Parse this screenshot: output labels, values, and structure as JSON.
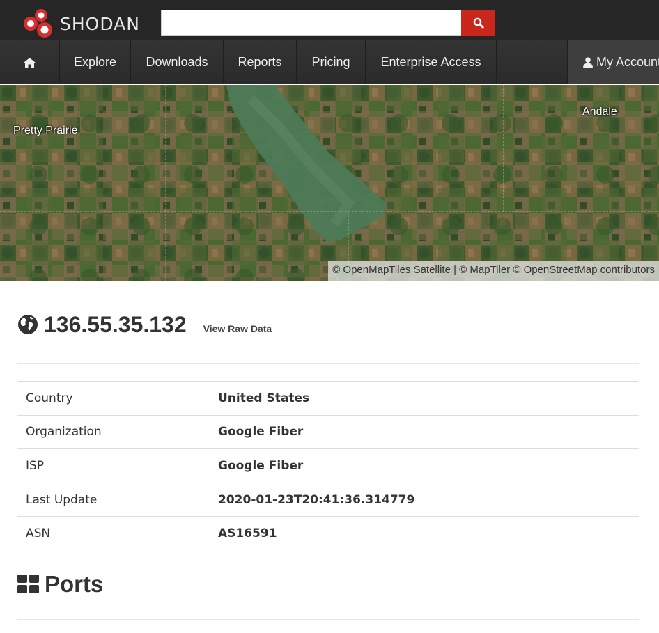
{
  "brand": {
    "name": "SHODAN"
  },
  "search": {
    "placeholder": "",
    "value": ""
  },
  "nav": {
    "items": [
      {
        "label": "Explore"
      },
      {
        "label": "Downloads"
      },
      {
        "label": "Reports"
      },
      {
        "label": "Pricing"
      },
      {
        "label": "Enterprise Access"
      }
    ],
    "account": "My Account"
  },
  "map": {
    "labels": [
      "Pretty Prairie",
      "Andale"
    ],
    "attribution": "© OpenMapTiles Satellite | © MapTiler © OpenStreetMap contributors"
  },
  "host": {
    "ip": "136.55.35.132",
    "raw_link": "View Raw Data",
    "details": [
      {
        "key": "Country",
        "value": "United States"
      },
      {
        "key": "Organization",
        "value": "Google Fiber"
      },
      {
        "key": "ISP",
        "value": "Google Fiber"
      },
      {
        "key": "Last Update",
        "value": "2020-01-23T20:41:36.314779"
      },
      {
        "key": "ASN",
        "value": "AS16591"
      }
    ]
  },
  "ports": {
    "title": "Ports"
  },
  "colors": {
    "header": "#262626",
    "search_button": "#c9261c",
    "brand_red": "#d62f2f"
  }
}
